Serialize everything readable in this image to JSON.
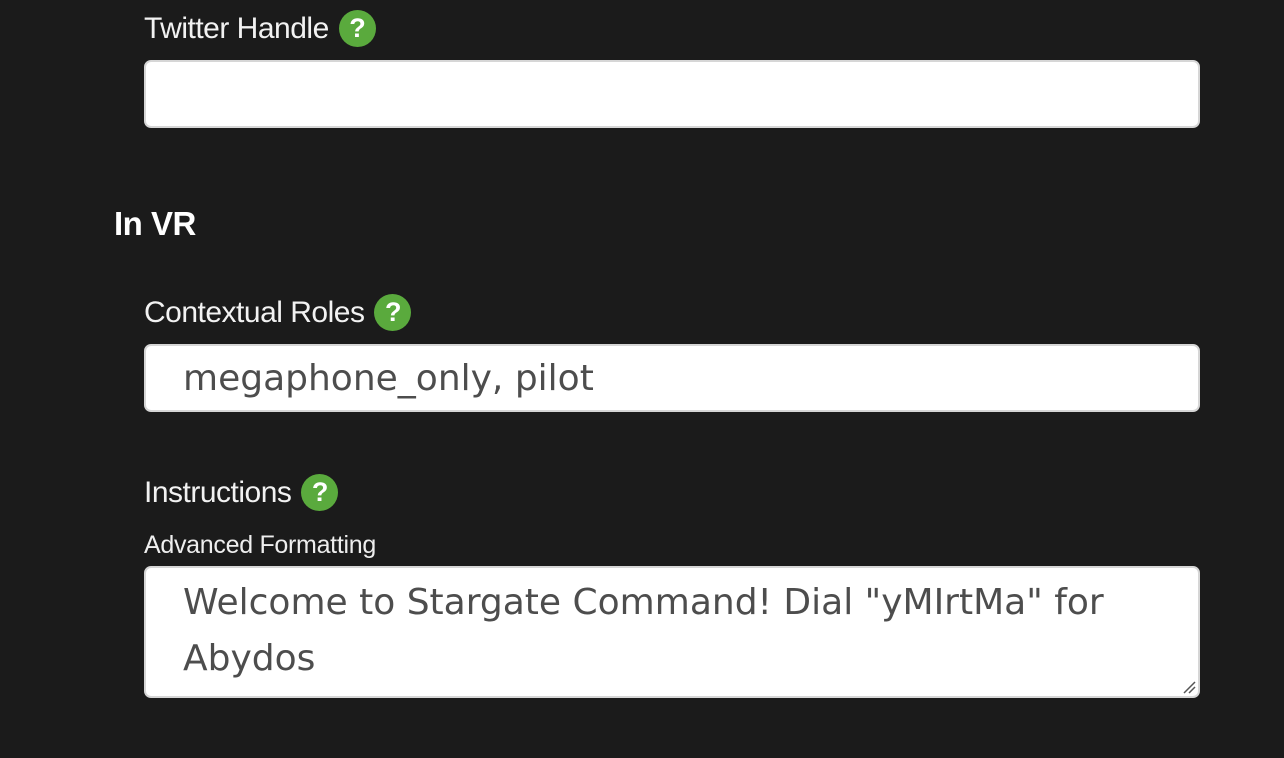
{
  "twitter_handle": {
    "label": "Twitter Handle",
    "value": "",
    "help_icon": "question-mark-icon"
  },
  "in_vr": {
    "heading": "In VR"
  },
  "contextual_roles": {
    "label": "Contextual Roles",
    "value": "megaphone_only, pilot",
    "help_icon": "question-mark-icon"
  },
  "instructions": {
    "label": "Instructions",
    "sub_label": "Advanced Formatting",
    "value": "Welcome to Stargate Command! Dial \"yMIrtMa\" for Abydos",
    "help_icon": "question-mark-icon"
  },
  "help_glyph": "?",
  "colors": {
    "background": "#1b1b1b",
    "help_icon": "#5aaa3d",
    "input_background": "#ffffff",
    "input_text": "#4d4d4d"
  }
}
